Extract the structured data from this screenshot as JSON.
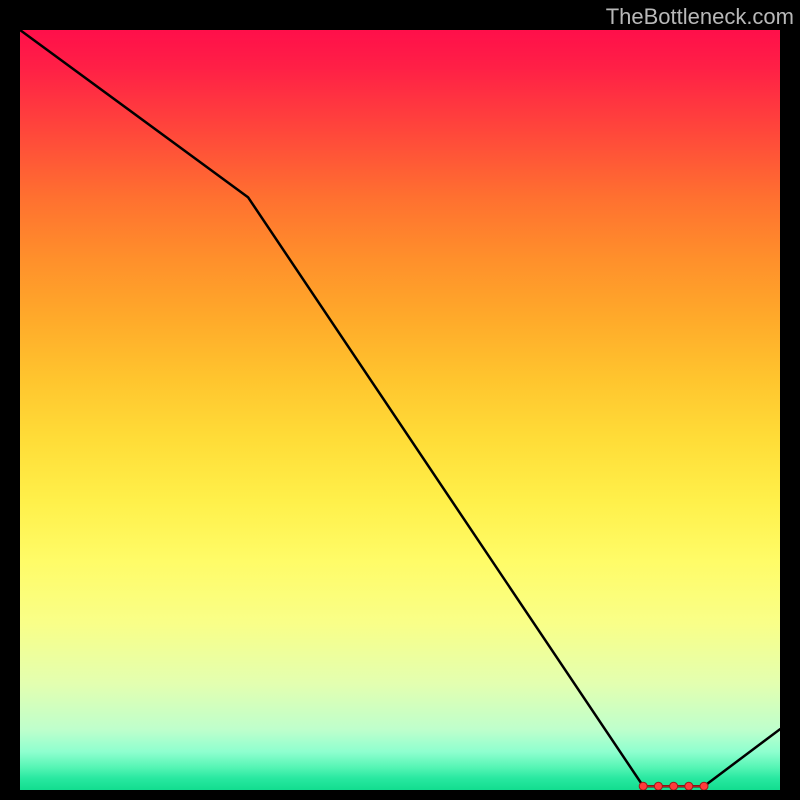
{
  "watermark": "TheBottleneck.com",
  "chart_data": {
    "type": "line",
    "title": "",
    "xlabel": "",
    "ylabel": "",
    "xlim": [
      0,
      100
    ],
    "ylim": [
      0,
      100
    ],
    "series": [
      {
        "name": "curve",
        "x": [
          0,
          30,
          82,
          90,
          100
        ],
        "y": [
          100,
          78,
          0.5,
          0.5,
          8
        ]
      }
    ],
    "markers": {
      "name": "highlight-dots",
      "x": [
        82,
        84,
        86,
        88,
        90
      ],
      "y": [
        0.5,
        0.5,
        0.5,
        0.5,
        0.5
      ]
    },
    "gradient_stops": [
      {
        "pct": 0,
        "color": "#ff0f4a"
      },
      {
        "pct": 50,
        "color": "#ffdd38"
      },
      {
        "pct": 100,
        "color": "#12dd8f"
      }
    ]
  }
}
